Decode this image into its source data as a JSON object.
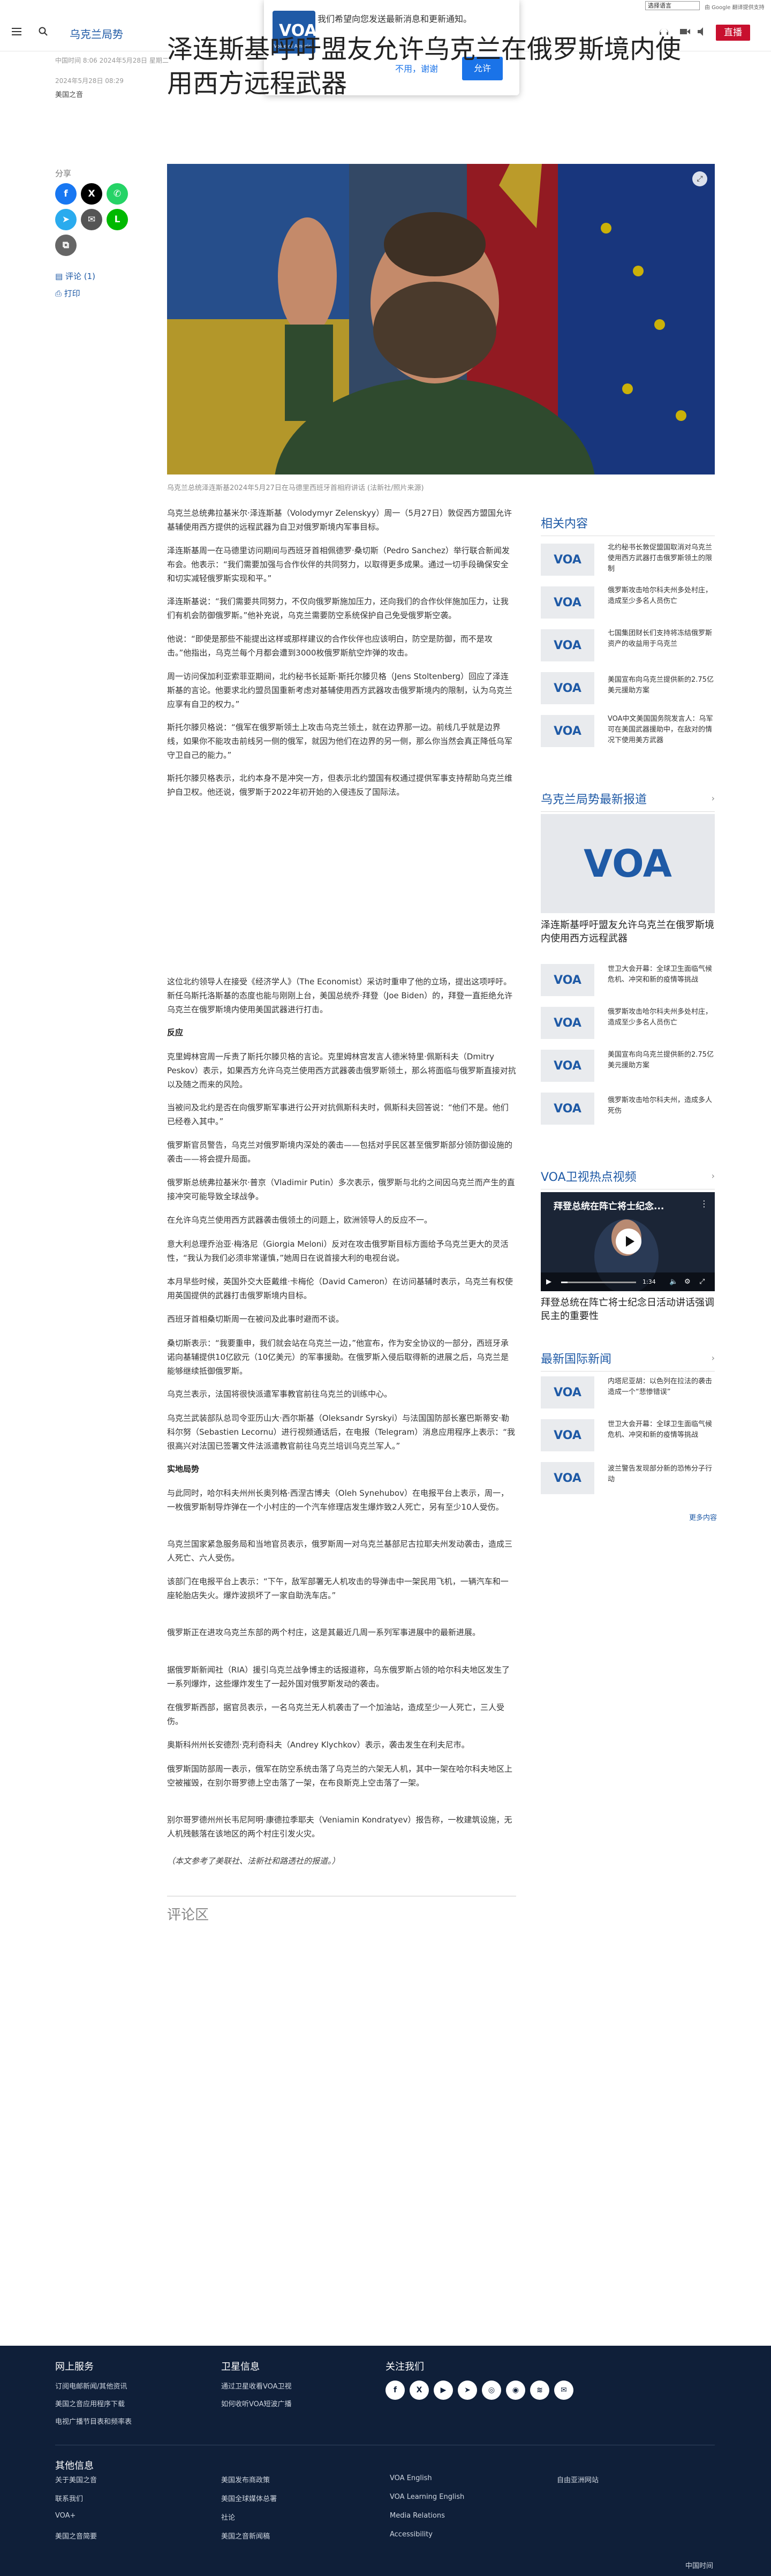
{
  "translate": {
    "select_label": "选择语言",
    "powered": "由 Google 翻译提供支持"
  },
  "header": {
    "section": "乌克兰局势",
    "logo": "VOA",
    "live": "直播"
  },
  "push": {
    "logo": "VOA",
    "logo_sub": "Voice of America",
    "message": "我们希望向您发送最新消息和更新通知。",
    "no": "不用，谢谢",
    "yes": "允许"
  },
  "meta": {
    "dates": "中国时间 8:06 2024年5月28日 星期二",
    "pub": "2024年5月28日 08:29",
    "byline": "美国之音"
  },
  "title": "泽连斯基呼吁盟友允许乌克兰在俄罗斯境内使用西方远程武器",
  "share": {
    "label": "分享",
    "comment": "评论 (1)",
    "print": "打印"
  },
  "caption": "乌克兰总统泽连斯基2024年5月27日在马德里西班牙首相府讲话 (法新社/照片来源)",
  "article": {
    "p1": "乌克兰总统弗拉基米尔·泽连斯基（Volodymyr Zelenskyy）周一（5月27日）敦促西方盟国允许基辅使用西方提供的远程武器为自卫对俄罗斯境内军事目标。",
    "p2": "泽连斯基周一在马德里访问期间与西班牙首相佩德罗·桑切斯（Pedro Sanchez）举行联合新闻发布会。他表示：“我们需要加强与合作伙伴的共同努力，以取得更多成果。通过一切手段确保安全和切实减轻俄罗斯实现和平。”",
    "p3": "泽连斯基说：“我们需要共同努力，不仅向俄罗斯施加压力，还向我们的合作伙伴施加压力，让我们有机会防御俄罗斯。”他补充说，乌克兰需要防空系统保护自己免受俄罗斯空袭。",
    "p4": "他说：“即使是那些不能提出这样或那样建议的合作伙伴也应该明白，防空是防御，而不是攻击。”他指出，乌克兰每个月都会遭到3000枚俄罗斯航空炸弹的攻击。",
    "p5": "周一访问保加利亚索菲亚期间，北约秘书长延斯·斯托尔滕贝格（Jens Stoltenberg）回应了泽连斯基的言论。他要求北约盟员国重新考虑对基辅使用西方武器攻击俄罗斯境内的限制，认为乌克兰应享有自卫的权力。”",
    "p6": "斯托尔滕贝格说：“俄军在俄罗斯领土上攻击乌克兰领土，就在边界那一边。前线几乎就是边界线，如果你不能攻击前线另一侧的俄军，就因为他们在边界的另一侧，那么你当然会真正降低乌军守卫自己的能力。”",
    "p7": "斯托尔滕贝格表示，北约本身不是冲突一方，但表示北约盟国有权通过提供军事支持帮助乌克兰维护自卫权。他还说，俄罗斯于2022年初开始的入侵违反了国际法。",
    "p8": "这位北约领导人在接受《经济学人》（The Economist）采访时重申了他的立场，提出这项呼吁。新任乌斯托洛斯基的态度也能与刚刚上台，美国总统乔·拜登（Joe Biden）的，拜登一直拒绝允许乌克兰在俄罗斯境内使用美国武器进行打击。",
    "h1": "反应",
    "p9": "克里姆林宫周一斥责了斯托尔滕贝格的言论。克里姆林宫发言人德米特里·佩斯科夫（Dmitry Peskov）表示，如果西方允许乌克兰使用西方武器袭击俄罗斯领土，那么将面临与俄罗斯直接对抗以及随之而来的风险。",
    "p10": "当被问及北约是否在向俄罗斯军事进行公开对抗佩斯科夫时，佩斯科夫回答说：“他们不是。他们已经卷入其中。”",
    "p11": "俄罗斯官员警告，乌克兰对俄罗斯境内深处的袭击——包括对乎民区甚至俄罗斯部分领防御设施的袭击——将会提升局面。",
    "p12": "俄罗斯总统弗拉基米尔·普京（Vladimir Putin）多次表示，俄罗斯与北约之间因乌克兰而产生的直接冲突可能导致全球战争。",
    "p13": "在允许乌克兰使用西方武器袭击俄领土的问题上，欧洲领导人的反应不一。",
    "p14": "意大利总理乔治亚·梅洛尼（Giorgia Meloni）反对在攻击俄罗斯目标方面给予乌克兰更大的灵活性，“我认为我们必须非常谨慎，”她周日在说首接大利的电视台说。",
    "p15": "本月早些时候，英国外交大臣戴维·卡梅伦（David Cameron）在访问基辅时表示，乌克兰有权使用英国提供的武器打击俄罗斯境内目标。",
    "p16": "西班牙首相桑切斯周一在被问及此事时避而不谈。",
    "p17": "桑切斯表示：“我要重申，我们就会站在乌克兰一边，”他宣布，作为安全协议的一部分，西班牙承诺向基辅提供10亿欧元（10亿美元）的军事援助。在俄罗斯入侵后取得新的进展之后，乌克兰是能够继续抵御俄罗斯。",
    "p18": "乌克兰表示，法国将很快派遣军事教官前往乌克兰的训练中心。",
    "p19": "乌克兰武装部队总司令亚历山大·西尔斯基（Oleksandr Syrskyi）与法国国防部长塞巴斯蒂安·勒科尔努（Sebastien Lecornu）进行视频通话后，在电报（Telegram）消息应用程序上表示：“我很高兴对法国已签署文件法派遣教官前往乌克兰培训乌克兰军人。”",
    "h2": "实地局势",
    "p20": "与此同时，哈尔科夫州州长奥列格·西涅古博夫（Oleh Synehubov）在电报平台上表示，周一，一枚俄罗斯制导炸弹在一个小村庄的一个汽车修理店发生爆炸致2人死亡，另有至少10人受伤。",
    "p21": "乌克兰国家紧急服务局和当地官员表示，俄罗斯周一对乌克兰基部尼古拉耶夫州发动袭击，造成三人死亡、六人受伤。",
    "p22": "该部门在电报平台上表示：“下午，敌军部署无人机攻击的导弹击中一架民用飞机，一辆汽车和一座轮胎店失火。爆炸波损坏了一家自助洗车店。”",
    "p23": "俄罗斯正在进攻乌克兰东部的两个村庄，这是其最近几周一系列军事进展中的最新进展。",
    "p24": "据俄罗斯新闻社（RIA）援引乌克兰战争博主的话报道称，乌东俄罗斯占领的哈尔科夫地区发生了一系列爆炸，这些爆炸发生了一起外国对俄罗斯发动的袭击。",
    "p25": "在俄罗斯西部，据官员表示，一名乌克兰无人机袭击了一个加油站，造成至少一人死亡，三人受伤。",
    "p26": "奥斯科州州长安德烈·克利奇科夫（Andrey Klychkov）表示，袭击发生在利夫尼市。",
    "p27": "俄罗斯国防部周一表示，俄军在防空系统击落了乌克兰的六架无人机，其中一架在哈尔科夫地区上空被摧毁，在别尔哥罗德上空击落了一架，在布良斯克上空击落了一架。",
    "p28": "别尔哥罗德州州长韦尼阿明·康德拉季耶夫（Veniamin Kondratyev）报告称，一枚建筑设施，无人机残骸落在该地区的两个村庄引发火灾。",
    "note": "（本文参考了美联社、法新社和路透社的报道。）"
  },
  "comments": "评论区",
  "sidebar": {
    "related_title": "相关内容",
    "related": [
      "北约秘书长敦促盟国取消对乌克兰使用西方武器打击俄罗斯领土的限制",
      "俄罗斯攻击哈尔科夫州多处村庄，造成至少多名人员伤亡",
      "七国集团财长们支持将冻结俄罗斯资产的收益用于乌克兰",
      "美国宣布向乌克兰提供新的2.75亿美元援助方案",
      "VOA中文美国国务院发言人：乌军可在美国武器援助中，在敌对的情况下使用美方武器"
    ],
    "latest_title": "乌克兰局势最新报道",
    "latest_main": "泽连斯基呼吁盟友允许乌克兰在俄罗斯境内使用西方远程武器",
    "latest": [
      "世卫大会开幕：全球卫生面临气候危机、冲突和新的疫情等挑战",
      "俄罗斯攻击哈尔科夫州多处村庄，造成至少多名人员伤亡",
      "美国宣布向乌克兰提供新的2.75亿美元援助方案",
      "俄罗斯攻击哈尔科夫州，造成多人死伤"
    ],
    "video_title": "VOA卫视热点视频",
    "video_overlay": "拜登总统在阵亡将士纪念...",
    "video_time": "1:34",
    "video_caption": "拜登总统在阵亡将士纪念日活动讲话强调民主的重要性",
    "intl_title": "最新国际新闻",
    "intl": [
      "内塔尼亚胡：以色列在拉法的袭击造成一个“悲惨错误”",
      "世卫大会开幕：全球卫生面临气候危机、冲突和新的疫情等挑战",
      "波兰警告发现部分新的恐怖分子行动"
    ],
    "more": "更多内容"
  },
  "footer": {
    "online": "网上服务",
    "tv": "卫星信息",
    "follow": "关注我们",
    "online_links": [
      "订阅电邮新闻/其他资讯",
      "美国之音应用程序下载",
      "电视广播节目表和频率表"
    ],
    "tv_links": [
      "通过卫星收看VOA卫视",
      "如何收听VOA短波广播"
    ],
    "other": "其他信息",
    "col1": [
      "关于美国之音",
      "联系我们",
      "VOA+",
      "美国之音简要"
    ],
    "col2": [
      "美国发布商政策",
      "美国全球媒体总署",
      "社论",
      "美国之音新闻稿"
    ],
    "col3": [
      "VOA English",
      "VOA Learning English",
      "Media Relations",
      "Accessibility"
    ],
    "col4": [
      "自由亚洲网站"
    ],
    "region": "中国时间"
  }
}
